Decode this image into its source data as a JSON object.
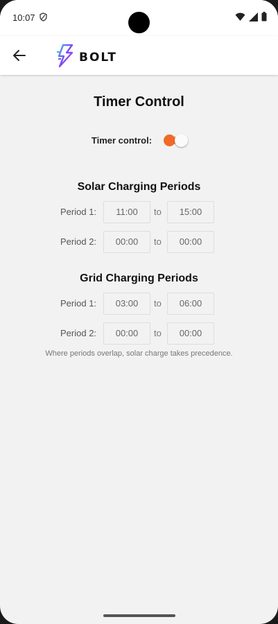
{
  "status_bar": {
    "time": "10:07"
  },
  "app_bar": {
    "logo_text": "BOLT"
  },
  "page": {
    "title": "Timer Control"
  },
  "timer_toggle": {
    "label": "Timer control:",
    "on": true,
    "accent_color": "#ef6a29"
  },
  "solar": {
    "title": "Solar Charging Periods",
    "periods": [
      {
        "label": "Period 1:",
        "start": "11:00",
        "to": "to",
        "end": "15:00"
      },
      {
        "label": "Period 2:",
        "start": "00:00",
        "to": "to",
        "end": "00:00"
      }
    ]
  },
  "grid": {
    "title": "Grid Charging Periods",
    "periods": [
      {
        "label": "Period 1:",
        "start": "03:00",
        "to": "to",
        "end": "06:00"
      },
      {
        "label": "Period 2:",
        "start": "00:00",
        "to": "to",
        "end": "00:00"
      }
    ]
  },
  "note": "Where periods overlap, solar charge takes precedence.",
  "icons": [
    "back-arrow-icon",
    "bolt-logo-icon",
    "shield-icon",
    "wifi-icon",
    "signal-icon",
    "battery-icon"
  ]
}
